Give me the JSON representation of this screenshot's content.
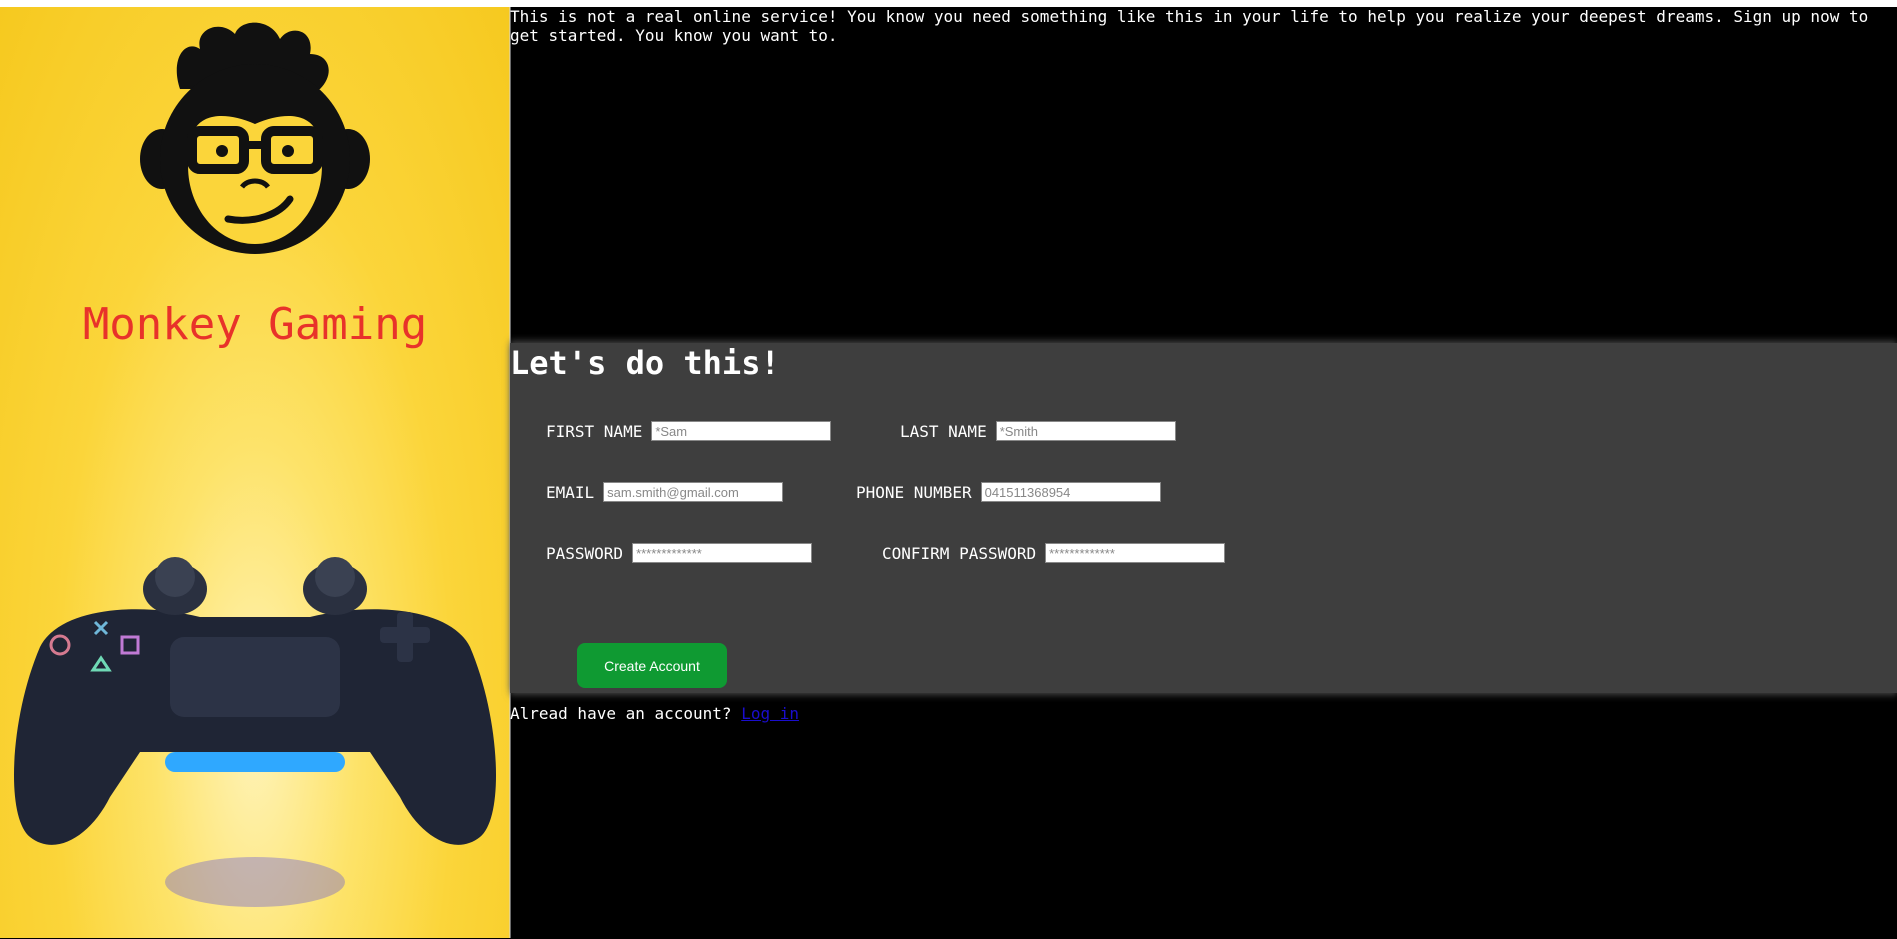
{
  "sidebar": {
    "brand": "Monkey Gaming"
  },
  "intro": {
    "text": "This is not a real online service! You know you need something like this in your life to help you realize your deepest dreams. Sign up now to get started. You know you want to."
  },
  "form": {
    "title": "Let's do this!",
    "first_name": {
      "label": "FIRST NAME",
      "placeholder": "*Sam"
    },
    "last_name": {
      "label": "LAST NAME",
      "placeholder": "*Smith"
    },
    "email": {
      "label": "EMAIL",
      "placeholder": "sam.smith@gmail.com"
    },
    "phone": {
      "label": "PHONE NUMBER",
      "placeholder": "041511368954"
    },
    "password": {
      "label": "PASSWORD",
      "placeholder": "*************"
    },
    "confirm_password": {
      "label": "CONFIRM PASSWORD",
      "placeholder": "*************"
    },
    "submit_label": "Create Account"
  },
  "login": {
    "prompt": "Alread have an account?",
    "link_label": "Log in"
  },
  "colors": {
    "sidebar_bg": "#fbd53a",
    "brand_text": "#e8322a",
    "form_bg": "#3e3e3e",
    "button_bg": "#0f9a32",
    "link": "#1a0dcc"
  }
}
